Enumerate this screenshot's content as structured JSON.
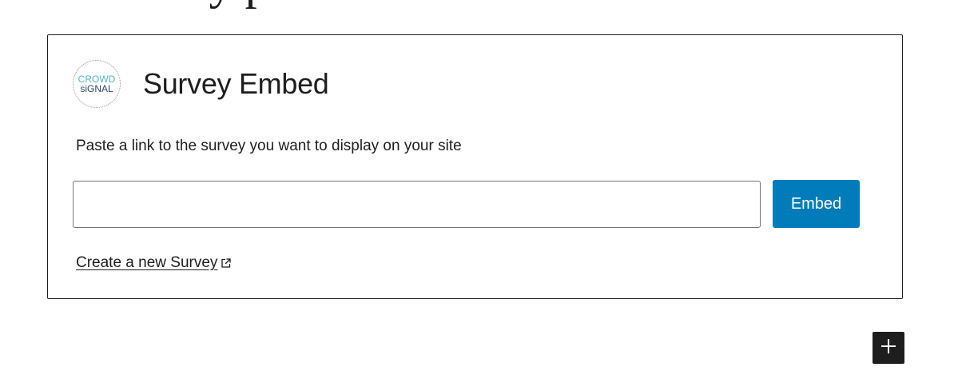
{
  "page_heading_fragment": "ey                                    p",
  "block": {
    "logo": {
      "line1": "CROWD",
      "line2": "siGNAL"
    },
    "title": "Survey Embed",
    "instructions": "Paste a link to the survey you want to display on your site",
    "input": {
      "value": "",
      "placeholder": ""
    },
    "embed_label": "Embed",
    "create_link_label": "Create a new Survey",
    "link_icon": "external-link-icon"
  },
  "toolbar": {
    "add_block_icon": "plus-icon"
  },
  "colors": {
    "accent": "#007cba",
    "border": "#1e1e1e",
    "input_border": "#757575",
    "logo_light": "#5ab5c9",
    "logo_dark": "#2b4a66"
  }
}
